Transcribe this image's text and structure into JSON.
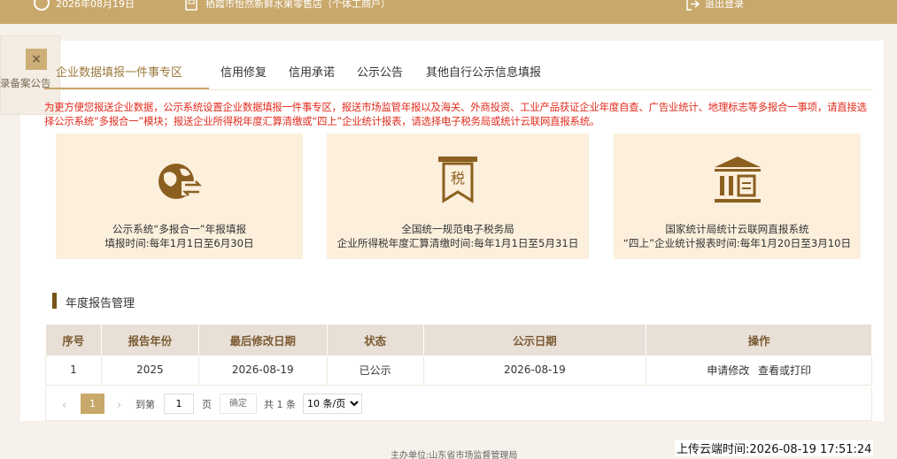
{
  "header": {
    "date": "2026年08月19日",
    "shop_name": "栖霞市怡然新鲜水果零售店（个体工商户）",
    "logout_label": "退出登录",
    "bg_color": "#c9a86b"
  },
  "notice_float": {
    "close_label": "×",
    "text": "录备案公告"
  },
  "tabs": [
    {
      "label": "企业数据填报一件事专区",
      "active": true
    },
    {
      "label": "信用修复"
    },
    {
      "label": "信用承诺"
    },
    {
      "label": "公示公告"
    },
    {
      "label": "其他自行公示信息填报"
    }
  ],
  "red_notice": "为更方便您报送企业数据，公示系统设置企业数据填报一件事专区，报送市场监管年报以及海关、外商投资、工业产品获证企业年度自查、广告业统计、地理标志等多报合一事项，请直接选择公示系统“多报合一”模块；报送企业所得税年度汇算清缴或“四上”企业统计报表，请选择电子税务局或统计云联网直报系统。",
  "cards": [
    {
      "icon": "globe-exchange-icon",
      "line1": "公示系统“多报合一”年报填报",
      "line2": "填报时间:每年1月1日至6月30日"
    },
    {
      "icon": "tax-badge-icon",
      "icon_text": "税",
      "line1": "全国统一规范电子税务局",
      "line2": "企业所得税年度汇算清缴时间:每年1月1日至5月31日"
    },
    {
      "icon": "bank-building-icon",
      "line1": "国家统计局统计云联网直报系统",
      "line2": "“四上”企业统计报表时间:每年1月20日至3月10日"
    }
  ],
  "section": {
    "title": "年度报告管理"
  },
  "table": {
    "headers": [
      "序号",
      "报告年份",
      "最后修改日期",
      "状态",
      "公示日期",
      "操作"
    ],
    "rows": [
      {
        "no": "1",
        "year": "2025",
        "modified": "2026-08-19",
        "status": "已公示",
        "public_date": "2026-08-19",
        "op1": "申请修改",
        "op2": "查看或打印"
      }
    ]
  },
  "pager": {
    "prev": "‹",
    "current": "1",
    "next": "›",
    "goto_label": "到第",
    "goto_value": "1",
    "page_label": "页",
    "ok_label": "确定",
    "total": "共 1 条",
    "size_options": [
      "10 条/页"
    ],
    "size_selected": "10 条/页"
  },
  "footer": {
    "host": "主办单位:山东省市场监督管理局",
    "upload_time": "上传云端时间:2026-08-19 17:51:24"
  },
  "colors": {
    "gold": "#c9a86b",
    "card_bg": "#fcefdc",
    "notice_red": "#e22b1d",
    "icon_brown": "#8a5f1f"
  }
}
